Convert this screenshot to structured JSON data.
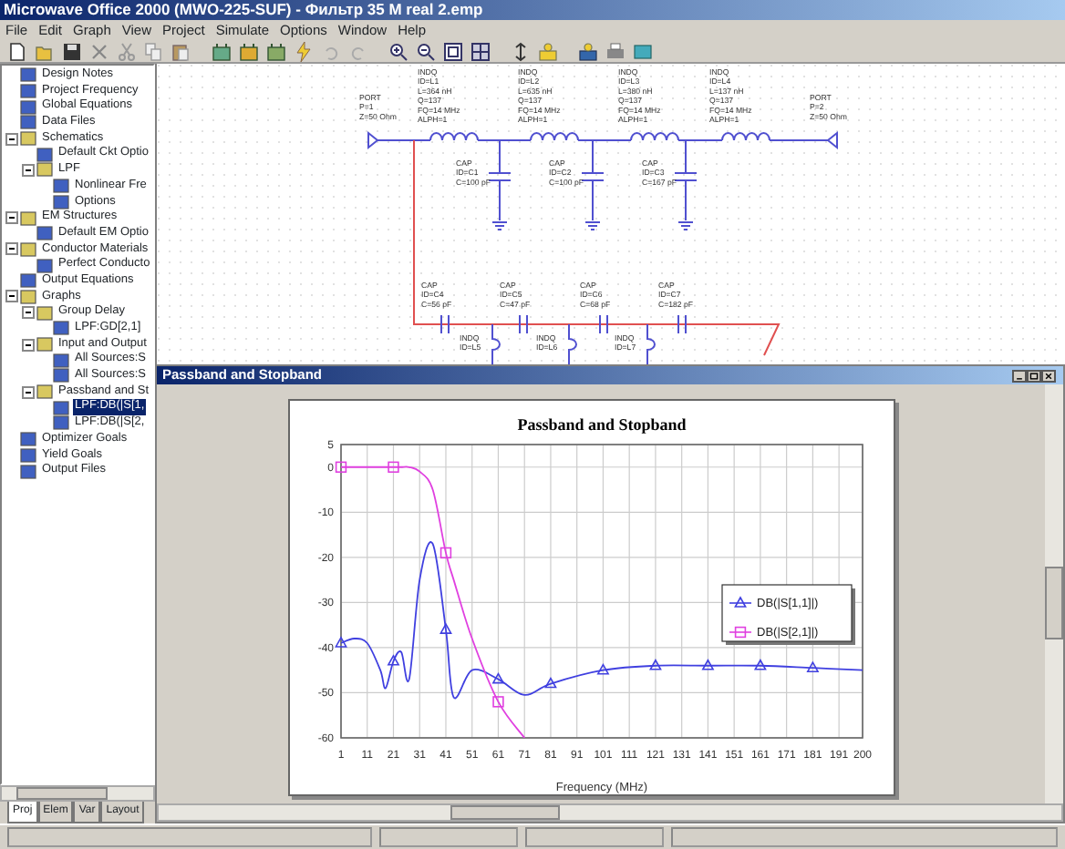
{
  "window": {
    "title": "Microwave Office 2000 (MWO-225-SUF) - Фильтр 35 M real 2.emp"
  },
  "menu": [
    "File",
    "Edit",
    "Graph",
    "View",
    "Project",
    "Simulate",
    "Options",
    "Window",
    "Help"
  ],
  "tree": {
    "items": [
      {
        "label": "Design Notes",
        "selected": false
      },
      {
        "label": "Project Frequency",
        "selected": false
      },
      {
        "label": "Global Equations",
        "selected": false
      },
      {
        "label": "Data Files",
        "selected": false
      },
      {
        "label": "Schematics",
        "selected": false,
        "expanded": true,
        "children": [
          {
            "label": "Default Ckt Optio",
            "selected": false
          },
          {
            "label": "LPF",
            "selected": false,
            "expanded": true,
            "children": [
              {
                "label": "Nonlinear Fre",
                "selected": false
              },
              {
                "label": "Options",
                "selected": false
              }
            ]
          }
        ]
      },
      {
        "label": "EM Structures",
        "selected": false,
        "expanded": true,
        "children": [
          {
            "label": "Default EM Optio",
            "selected": false
          }
        ]
      },
      {
        "label": "Conductor Materials",
        "selected": false,
        "expanded": true,
        "children": [
          {
            "label": "Perfect Conducto",
            "selected": false
          }
        ]
      },
      {
        "label": "Output Equations",
        "selected": false
      },
      {
        "label": "Graphs",
        "selected": false,
        "expanded": true,
        "children": [
          {
            "label": "Group Delay",
            "selected": false,
            "expanded": true,
            "children": [
              {
                "label": "LPF:GD[2,1]",
                "selected": false
              }
            ]
          },
          {
            "label": "Input and Output",
            "selected": false,
            "expanded": true,
            "children": [
              {
                "label": "All Sources:S",
                "selected": false
              },
              {
                "label": "All Sources:S",
                "selected": false
              }
            ]
          },
          {
            "label": "Passband and St",
            "selected": false,
            "expanded": true,
            "children": [
              {
                "label": "LPF:DB(|S[1,",
                "selected": true
              },
              {
                "label": "LPF:DB(|S[2,",
                "selected": false
              }
            ]
          }
        ]
      },
      {
        "label": "Optimizer Goals",
        "selected": false
      },
      {
        "label": "Yield Goals",
        "selected": false
      },
      {
        "label": "Output Files",
        "selected": false
      }
    ]
  },
  "pane_tabs": [
    {
      "label": "Proj",
      "selected": true
    },
    {
      "label": "Elem",
      "selected": false
    },
    {
      "label": "Var",
      "selected": false
    },
    {
      "label": "Layout",
      "selected": false
    }
  ],
  "schematic": {
    "components": [
      {
        "kind": "port",
        "labels": [
          "PORT",
          "P=1",
          "Z=50 Ohm"
        ]
      },
      {
        "kind": "inductor",
        "labels": [
          "INDQ",
          "ID=L1",
          "L=364 nH",
          "Q=137",
          "FQ=14 MHz",
          "ALPH=1"
        ]
      },
      {
        "kind": "inductor",
        "labels": [
          "INDQ",
          "ID=L2",
          "L=635 nH",
          "Q=137",
          "FQ=14 MHz",
          "ALPH=1"
        ]
      },
      {
        "kind": "inductor",
        "labels": [
          "INDQ",
          "ID=L3",
          "L=380 nH",
          "Q=137",
          "FQ=14 MHz",
          "ALPH=1"
        ]
      },
      {
        "kind": "inductor",
        "labels": [
          "INDQ",
          "ID=L4",
          "L=137 nH",
          "Q=137",
          "FQ=14 MHz",
          "ALPH=1"
        ]
      },
      {
        "kind": "port",
        "labels": [
          "PORT",
          "P=2",
          "Z=50 Ohm"
        ]
      },
      {
        "kind": "capacitor",
        "labels": [
          "CAP",
          "ID=C1",
          "C=100 pF"
        ]
      },
      {
        "kind": "capacitor",
        "labels": [
          "CAP",
          "ID=C2",
          "C=100 pF"
        ]
      },
      {
        "kind": "capacitor",
        "labels": [
          "CAP",
          "ID=C3",
          "C=167 pF"
        ]
      },
      {
        "kind": "series_capacitor",
        "labels": [
          "CAP",
          "ID=C4",
          "C=56 pF"
        ]
      },
      {
        "kind": "series_capacitor",
        "labels": [
          "CAP",
          "ID=C5",
          "C=47 pF"
        ]
      },
      {
        "kind": "series_capacitor",
        "labels": [
          "CAP",
          "ID=C6",
          "C=68 pF"
        ]
      },
      {
        "kind": "series_capacitor",
        "labels": [
          "CAP",
          "ID=C7",
          "C=182 pF"
        ]
      },
      {
        "kind": "shunt_inductor",
        "labels": [
          "INDQ",
          "ID=L5"
        ]
      },
      {
        "kind": "shunt_inductor",
        "labels": [
          "INDQ",
          "ID=L6"
        ]
      },
      {
        "kind": "shunt_inductor",
        "labels": [
          "INDQ",
          "ID=L7"
        ]
      }
    ]
  },
  "graph_window": {
    "title": "Passband and Stopband",
    "chart_data": {
      "type": "line",
      "title": "Passband and Stopband",
      "xlabel": "Frequency (MHz)",
      "x": [
        1,
        6,
        11,
        16,
        18,
        21,
        24,
        27,
        31,
        36,
        41,
        44,
        51,
        61,
        71,
        81,
        101,
        121,
        141,
        161,
        181,
        200
      ],
      "series": [
        {
          "name": "DB(|S[1,1]|)",
          "color": "#4040e0",
          "values": [
            -39,
            -38,
            -39,
            -45,
            -49,
            -43,
            -41,
            -47,
            -25,
            -17,
            -36,
            -51,
            -45,
            -47,
            -50.5,
            -48,
            -45,
            -44,
            -44,
            -44,
            -44.5,
            -45
          ]
        },
        {
          "name": "DB(|S[2,1]|)",
          "color": "#e040e0",
          "values": [
            0,
            0,
            0,
            0,
            0,
            0,
            0,
            0,
            -1,
            -5,
            -19,
            -25,
            -38,
            -52,
            -60,
            null,
            null,
            null,
            null,
            null,
            null,
            null
          ]
        }
      ],
      "grid": true,
      "legend": true,
      "xlim": [
        1,
        200
      ],
      "ylim": [
        -60,
        5
      ],
      "xticks": [
        1,
        11,
        21,
        31,
        41,
        51,
        61,
        71,
        81,
        91,
        101,
        111,
        121,
        131,
        141,
        151,
        161,
        171,
        181,
        191,
        200
      ],
      "yticks": [
        5,
        0,
        -10,
        -20,
        -30,
        -40,
        -50,
        -60
      ]
    }
  }
}
